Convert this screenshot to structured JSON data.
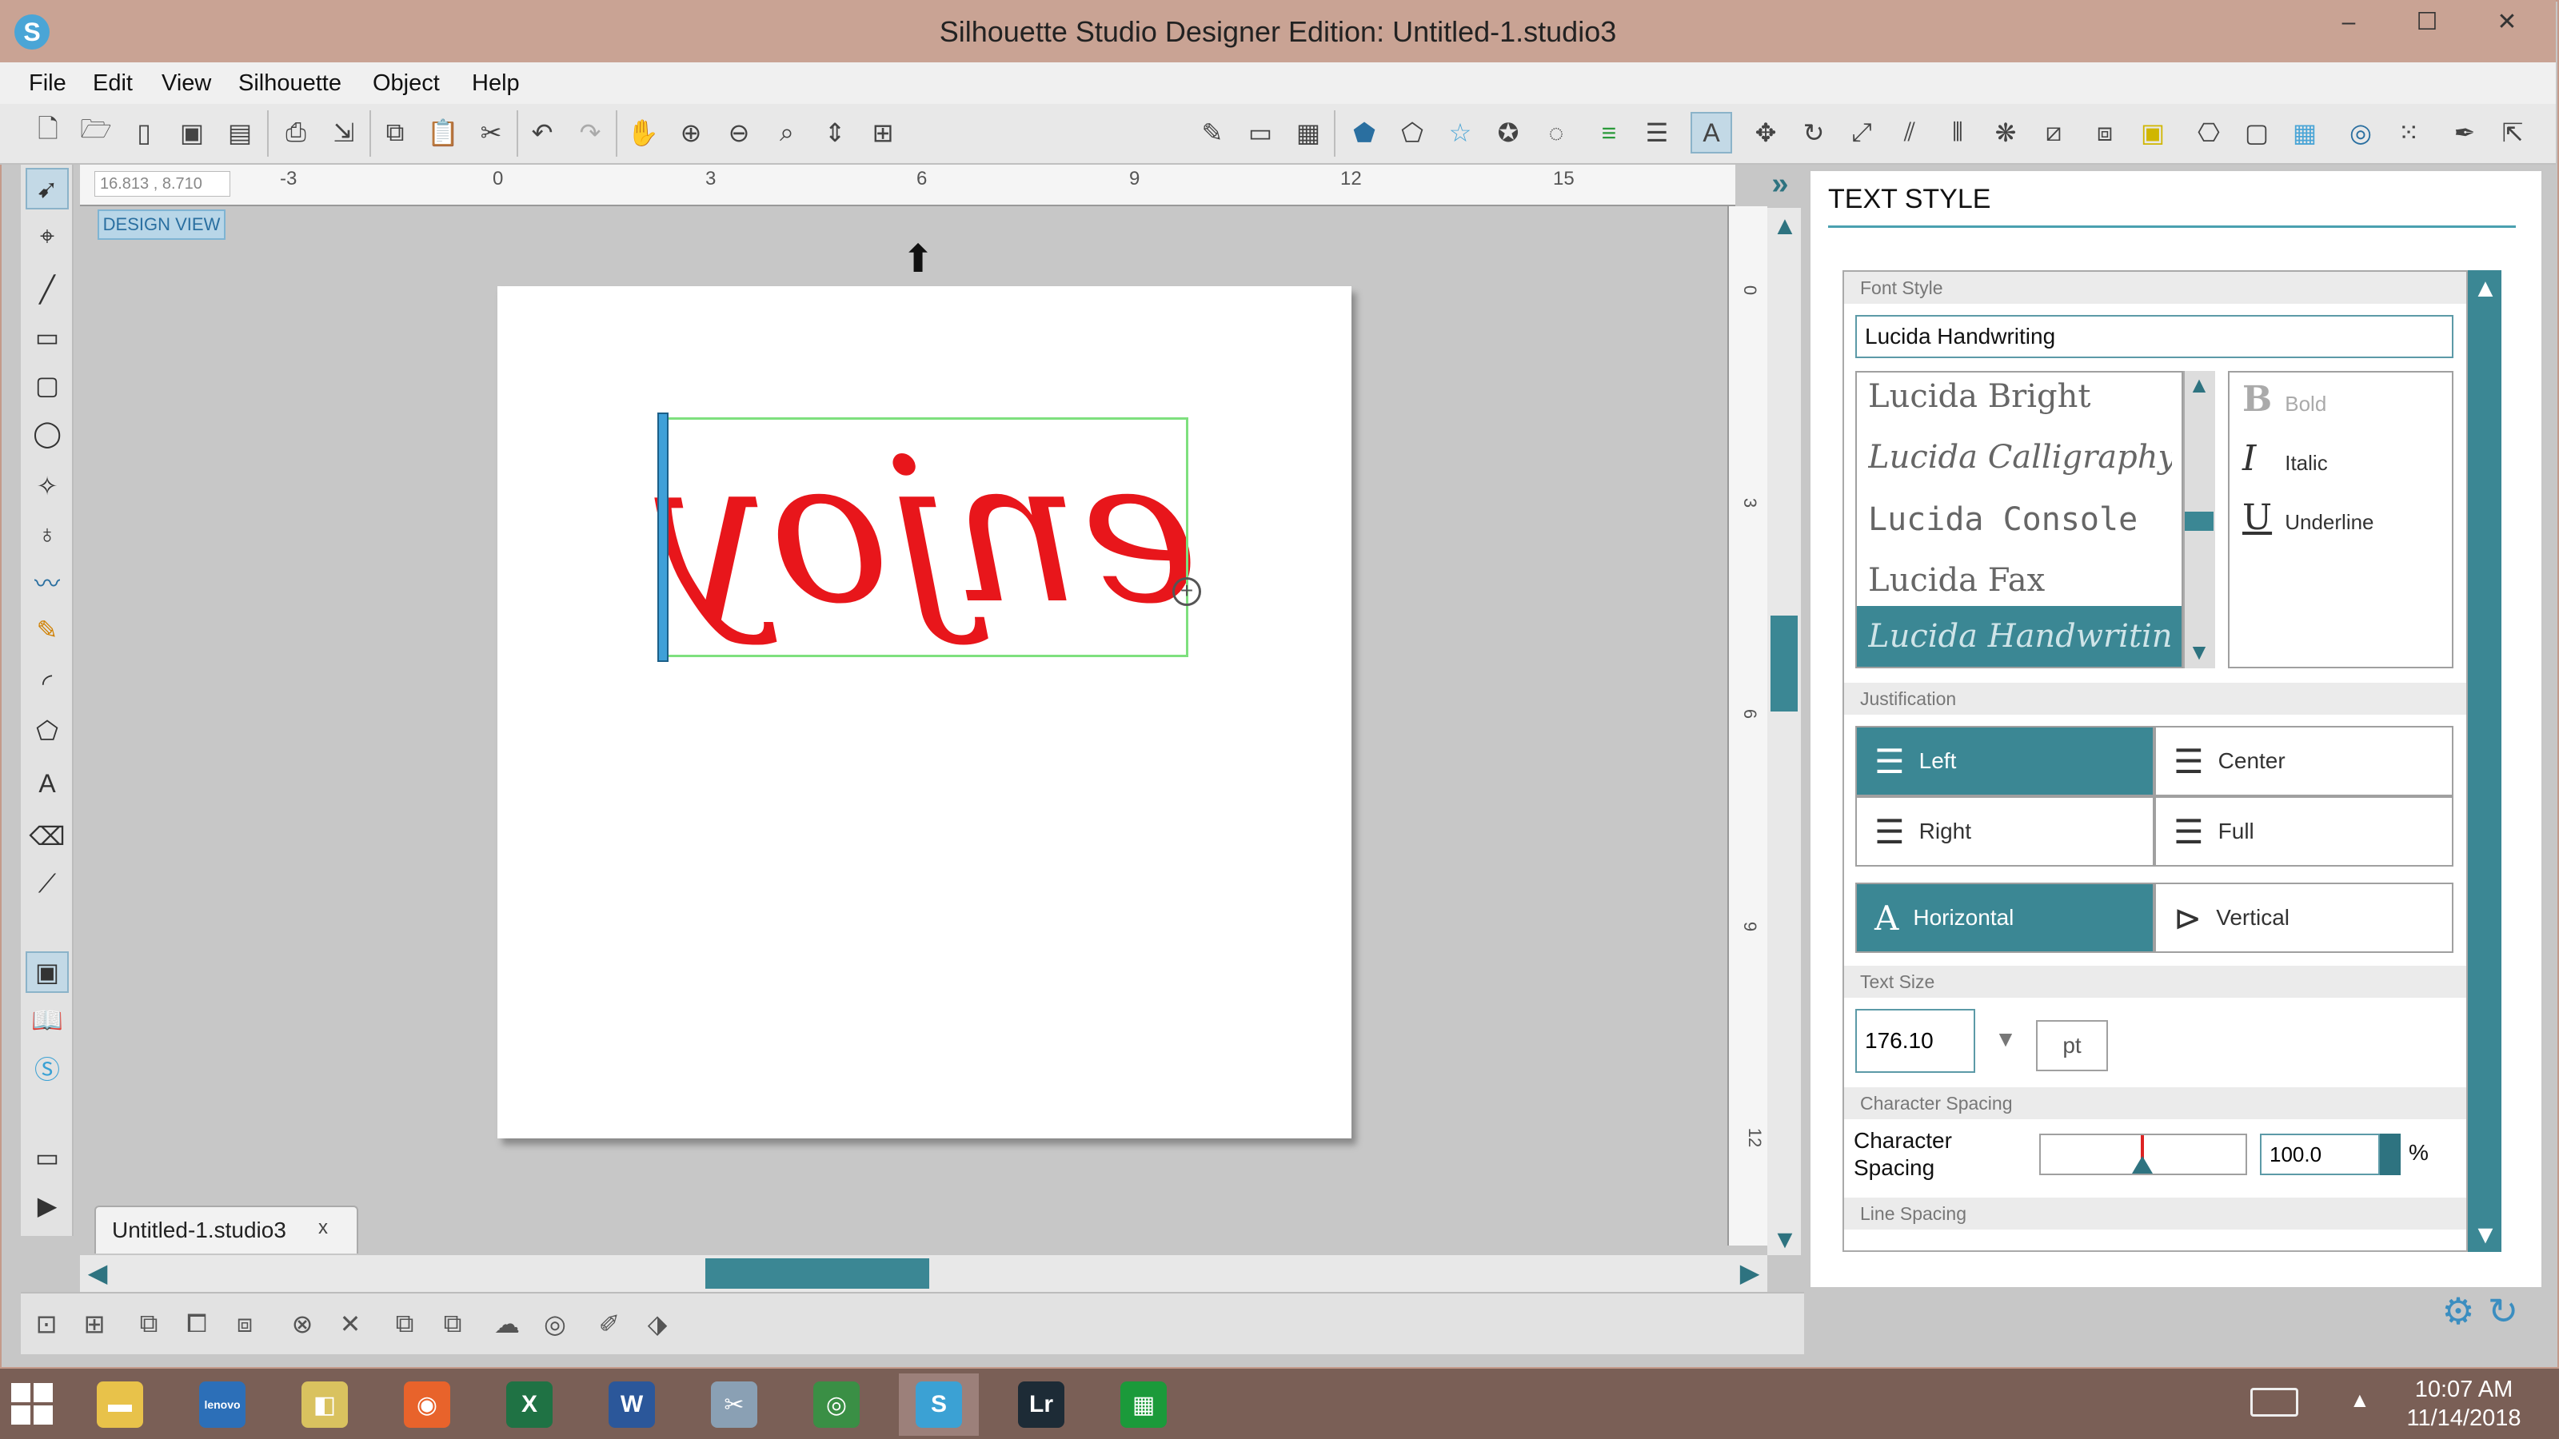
{
  "window": {
    "title": "Silhouette Studio Designer Edition: Untitled-1.studio3",
    "logo": "S",
    "controls": {
      "minimize": "–",
      "maximize": "☐",
      "close": "✕"
    }
  },
  "menu": [
    "File",
    "Edit",
    "View",
    "Silhouette",
    "Object",
    "Help"
  ],
  "canvas": {
    "coords": "16.813 , 8.710",
    "design_view": "DESIGN VIEW",
    "ruler_top": [
      "-3",
      "0",
      "3",
      "6",
      "9",
      "12",
      "15"
    ],
    "ruler_left": [
      "0",
      "3",
      "6",
      "9",
      "12"
    ],
    "text_content": "enjoy",
    "doc_tab": "Untitled-1.studio3",
    "doc_tab_close": "x"
  },
  "panel": {
    "title": "TEXT STYLE",
    "font_style_label": "Font Style",
    "font_input_value": "Lucida Handwriting",
    "fonts": [
      "Lucida Bright",
      "Lucida Calligraphy",
      "Lucida Console",
      "Lucida Fax",
      "Lucida Handwriting"
    ],
    "selected_font_index": 4,
    "styles": [
      {
        "icon": "B",
        "label": "Bold"
      },
      {
        "icon": "I",
        "label": "Italic"
      },
      {
        "icon": "U",
        "label": "Underline"
      }
    ],
    "justification_label": "Justification",
    "justification": {
      "left": "Left",
      "center": "Center",
      "right": "Right",
      "full": "Full"
    },
    "orientation": {
      "horizontal": "Horizontal",
      "vertical": "Vertical"
    },
    "text_size_label": "Text Size",
    "text_size_value": "176.10",
    "text_size_unit": "pt",
    "char_spacing_section": "Character Spacing",
    "char_spacing_label": "Character Spacing",
    "char_spacing_value": "100.0",
    "char_spacing_unit": "%",
    "line_spacing_label": "Line Spacing"
  },
  "taskbar": {
    "time": "10:07 AM",
    "date": "11/14/2018",
    "apps": [
      {
        "name": "file-explorer",
        "glyph": "▬",
        "color": "#e8c24a"
      },
      {
        "name": "lenovo",
        "glyph": "lenovo",
        "color": "#2c6fb8"
      },
      {
        "name": "photos",
        "glyph": "◧",
        "color": "#d9c25f"
      },
      {
        "name": "firefox",
        "glyph": "◉",
        "color": "#e8632b"
      },
      {
        "name": "excel",
        "glyph": "X",
        "color": "#1f7244"
      },
      {
        "name": "word",
        "glyph": "W",
        "color": "#2b579a"
      },
      {
        "name": "snipping-tool",
        "glyph": "✂",
        "color": "#8aa0b4"
      },
      {
        "name": "chrome",
        "glyph": "◎",
        "color": "#3a8f45"
      },
      {
        "name": "silhouette",
        "glyph": "S",
        "color": "#3ba1d4"
      },
      {
        "name": "lightroom",
        "glyph": "Lr",
        "color": "#1d2b36"
      },
      {
        "name": "calculator",
        "glyph": "▦",
        "color": "#1b9a3a"
      }
    ]
  },
  "colors": {
    "accent": "#3b8794",
    "text_fill": "#e8161b",
    "selection": "#7ee07e"
  }
}
